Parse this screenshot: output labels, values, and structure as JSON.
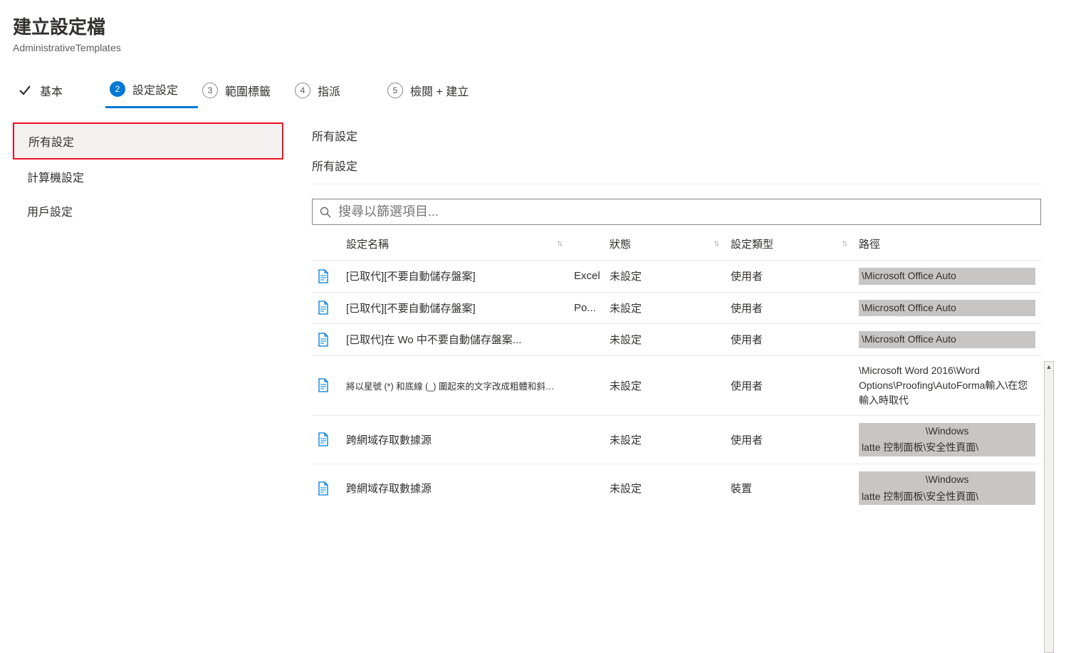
{
  "header": {
    "title": "建立設定檔",
    "subtitle": "AdministrativeTemplates"
  },
  "wizard": {
    "steps": [
      {
        "num": "",
        "label": "基本",
        "done": true
      },
      {
        "num": "2",
        "label": "設定設定",
        "active": true
      },
      {
        "num": "3",
        "label": "範圍標籤"
      },
      {
        "num": "4",
        "label": "指派"
      },
      {
        "num": "5",
        "label": "檢閱 + 建立"
      }
    ]
  },
  "sidebar": {
    "items": [
      {
        "label": "所有設定",
        "selected": true
      },
      {
        "label": "計算機設定"
      },
      {
        "label": "用戶設定"
      }
    ]
  },
  "content": {
    "breadcrumb": "所有設定",
    "section": "所有設定",
    "search_placeholder": "搜尋以篩選項目..."
  },
  "table": {
    "columns": {
      "name": "設定名稱",
      "state": "狀態",
      "type": "設定類型",
      "path": "路徑"
    },
    "rows": [
      {
        "name": "[已取代][不要自動儲存盤案]",
        "extra": "Excel",
        "state": "未設定",
        "type": "使用者",
        "path": "\\Microsoft Office Auto",
        "path_style": "hl"
      },
      {
        "name": "[已取代][不要自動儲存盤案]",
        "extra": "Po...",
        "state": "未設定",
        "type": "使用者",
        "path": "\\Microsoft Office Auto",
        "path_style": "hl"
      },
      {
        "name": "[已取代]在 Wo 中不要自動儲存盤案...",
        "extra": "",
        "state": "未設定",
        "type": "使用者",
        "path": "\\Microsoft Office Auto",
        "path_style": "hl"
      },
      {
        "name": "將以星號 (*) 和底線 (_) 圍起來的文字改成粗體和斜體的格式",
        "extra": "",
        "state": "未設定",
        "type": "使用者",
        "path": "\\Microsoft Word 2016\\Word Options\\Proofing\\AutoForma輸入\\在您輸入時取代",
        "path_style": "plain",
        "small": true
      },
      {
        "name": "跨網域存取數據源",
        "extra": "",
        "state": "未設定",
        "type": "使用者",
        "path": "\\Windows\nlatte 控制面板\\安全性頁面\\",
        "path_style": "hl-center"
      },
      {
        "name": "跨網域存取數據源",
        "extra": "",
        "state": "未設定",
        "type": "裝置",
        "path": "\\Windows\nlatte 控制面板\\安全性頁面\\",
        "path_style": "hl-center"
      }
    ]
  }
}
